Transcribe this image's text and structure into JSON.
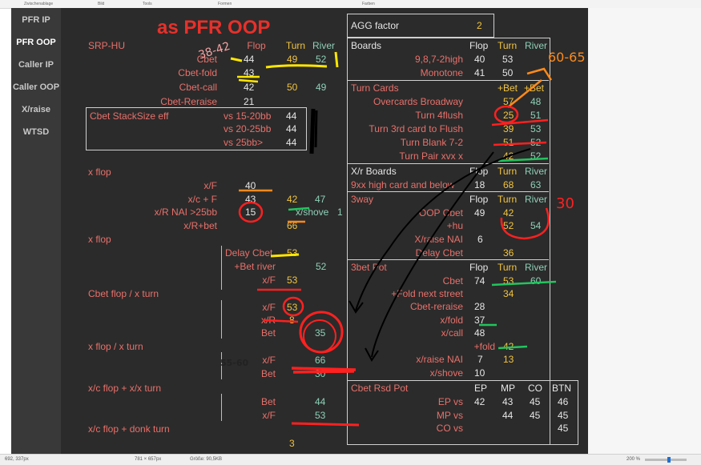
{
  "window": {
    "menu": [
      "Zwischenablage",
      "Bild",
      "Tools",
      "Formen",
      "Farben"
    ]
  },
  "sidebar": {
    "items": [
      {
        "label": "PFR IP",
        "active": false
      },
      {
        "label": "PFR OOP",
        "active": true
      },
      {
        "label": "Caller IP",
        "active": false
      },
      {
        "label": "Caller OOP",
        "active": false
      },
      {
        "label": "X/raise",
        "active": false
      },
      {
        "label": "WTSD",
        "active": false
      }
    ]
  },
  "title": "as PFR OOP",
  "left": {
    "srp_hu": "SRP-HU",
    "headers": {
      "flop": "Flop",
      "turn": "Turn",
      "river": "River"
    },
    "rows": [
      {
        "label": "Cbet",
        "flop": "44",
        "turn": "49",
        "river": "52"
      },
      {
        "label": "Cbet-fold",
        "flop": "43",
        "turn": "",
        "river": ""
      },
      {
        "label": "Cbet-call",
        "flop": "42",
        "turn": "50",
        "river": "49"
      },
      {
        "label": "Cbet-Reraise",
        "flop": "21",
        "turn": "",
        "river": ""
      }
    ],
    "stack": {
      "title": "Cbet  StackSize eff",
      "rows": [
        {
          "label": "vs 15-20bb",
          "value": "44"
        },
        {
          "label": "vs 20-25bb",
          "value": "44"
        },
        {
          "label": "vs 25bb>",
          "value": "44"
        }
      ]
    },
    "xflop1": {
      "title": "x flop",
      "rows": [
        {
          "label": "x/F",
          "v1": "40",
          "v2": "",
          "v3": ""
        },
        {
          "label": "x/c + F",
          "v1": "43",
          "v2": "42",
          "v3": "47"
        },
        {
          "label": "x/R NAI >25bb",
          "v1": "15",
          "v2": "x/shove",
          "v3": "1"
        },
        {
          "label": "x/R+bet",
          "v1": "",
          "v2": "66",
          "v3": ""
        }
      ]
    },
    "xflop2": {
      "title": "x flop",
      "rows": [
        {
          "label": "Delay Cbet",
          "value": "53",
          "extra": ""
        },
        {
          "label": "+Bet river",
          "value": "",
          "extra": "52"
        },
        {
          "label": "x/F",
          "value": "53",
          "extra": ""
        }
      ]
    },
    "cbet_xturn": {
      "title": "Cbet flop / x turn",
      "rows": [
        {
          "label": "x/F",
          "value": "53"
        },
        {
          "label": "x/R",
          "value": "8"
        },
        {
          "label": "Bet",
          "value": "35"
        }
      ]
    },
    "xflop_xturn": {
      "title": "x flop / x turn",
      "rows": [
        {
          "label": "x/F",
          "value": "66"
        },
        {
          "label": "Bet",
          "value": "30"
        }
      ]
    },
    "xc_xx": {
      "title": "x/c flop + x/x turn",
      "rows": [
        {
          "label": "Bet",
          "value": "44"
        },
        {
          "label": "x/F",
          "value": "53"
        }
      ]
    },
    "xc_donk": {
      "title": "x/c flop + donk turn",
      "value": "3"
    }
  },
  "right": {
    "agg": {
      "label": "AGG factor",
      "value": "2"
    },
    "boards": {
      "title": "Boards",
      "headers": {
        "flop": "Flop",
        "turn": "Turn",
        "river": "River"
      },
      "rows": [
        {
          "label": "9,8,7-2high",
          "flop": "40",
          "turn": "53"
        },
        {
          "label": "Monotone",
          "flop": "41",
          "turn": "50"
        }
      ]
    },
    "turn_cards": {
      "title": "Turn Cards",
      "h1": "+Bet",
      "h2": "+Bet",
      "rows": [
        {
          "label": "Overcards Broadway",
          "a": "57",
          "b": "48"
        },
        {
          "label": "Turn 4flush",
          "a": "25",
          "b": "51"
        },
        {
          "label": "Turn 3rd card to Flush",
          "a": "39",
          "b": "53"
        },
        {
          "label": "Turn Blank 7-2",
          "a": "51",
          "b": "52"
        },
        {
          "label": "Turn Pair xvx x",
          "a": "42",
          "b": "52"
        }
      ]
    },
    "xr_boards": {
      "title": "X/r Boards",
      "headers": {
        "flop": "Flop",
        "turn": "Turn",
        "river": "River"
      },
      "row": {
        "label": "9xx high card and below",
        "flop": "18",
        "turn": "68",
        "river": "63"
      }
    },
    "threeway": {
      "title": "3way",
      "headers": {
        "flop": "Flop",
        "turn": "Turn",
        "river": "River"
      },
      "rows": [
        {
          "label": "OOP Cbet",
          "flop": "49",
          "turn": "42",
          "river": ""
        },
        {
          "label": "+hu",
          "flop": "",
          "turn": "52",
          "river": "54"
        },
        {
          "label": "X/raise NAI",
          "flop": "6",
          "turn": "",
          "river": ""
        },
        {
          "label": "Delay Cbet",
          "flop": "",
          "turn": "36",
          "river": ""
        }
      ]
    },
    "threebet": {
      "title": "3bet Pot",
      "headers": {
        "flop": "Flop",
        "turn": "Turn",
        "river": "River"
      },
      "rows": [
        {
          "label": "Cbet",
          "flop": "74",
          "turn": "53",
          "river": "60"
        },
        {
          "label": "+Fold next street",
          "flop": "",
          "turn": "34",
          "river": ""
        },
        {
          "label": "Cbet-reraise",
          "flop": "28",
          "turn": "",
          "river": ""
        },
        {
          "label": "x/fold",
          "flop": "37",
          "turn": "",
          "river": ""
        },
        {
          "label": "x/call",
          "flop": "48",
          "turn": "",
          "river": ""
        },
        {
          "label": "+fold",
          "flop": "",
          "turn": "42",
          "river": ""
        },
        {
          "label": "x/raise NAI",
          "flop": "7",
          "turn": "13",
          "river": ""
        },
        {
          "label": "x/shove",
          "flop": "10",
          "turn": "",
          "river": ""
        }
      ]
    },
    "cbet_rsd": {
      "title": "Cbet Rsd Pot",
      "headers": [
        "EP",
        "MP",
        "CO",
        "BTN"
      ],
      "rows": [
        {
          "label": "EP vs",
          "ep": "42",
          "mp": "43",
          "co": "45",
          "btn": "46"
        },
        {
          "label": "MP vs",
          "ep": "",
          "mp": "44",
          "co": "45",
          "btn": "45"
        },
        {
          "label": "CO vs",
          "ep": "",
          "mp": "",
          "co": "",
          "btn": "45"
        }
      ]
    }
  },
  "annotations": {
    "handwriting": [
      "38-42",
      "60-65",
      "55-60"
    ]
  },
  "statusbar": {
    "cursor": "692, 337px",
    "selection": "781 × 657px",
    "size": "Größe: 90,5KB",
    "zoom": "200 %"
  },
  "colors": {
    "background": "#2b2b2b",
    "sidebar": "#393939",
    "label_red": "#e8706a",
    "title_red": "#e8302a",
    "value_yellow": "#f2c440",
    "value_green": "#8fd0b8",
    "value_white": "#e6e6e6",
    "ink_orange": "#ff8a1a",
    "ink_yellow": "#ffe600",
    "ink_green": "#22c55e"
  }
}
